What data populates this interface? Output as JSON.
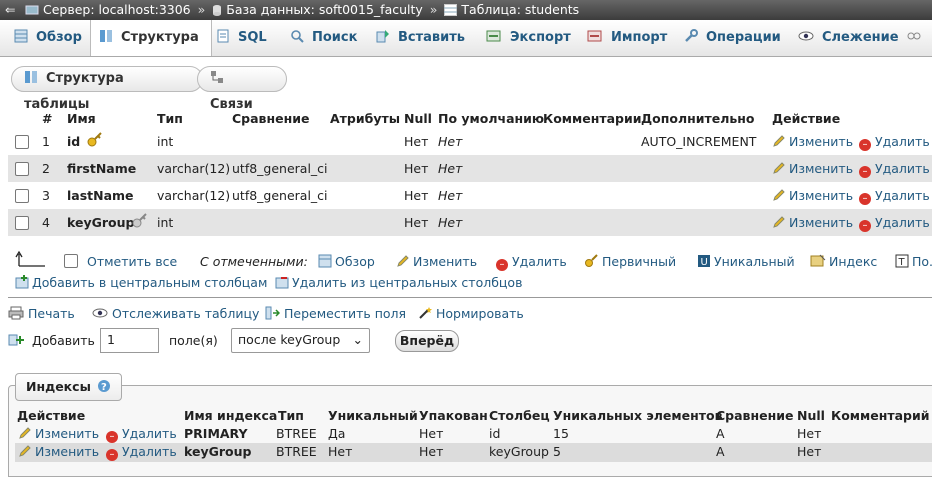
{
  "breadcrumb": {
    "server": "Сервер: localhost:3306",
    "database": "База данных: soft0015_faculty",
    "table": "Таблица: students",
    "sep": "»"
  },
  "tabs": [
    {
      "label": "Обзор",
      "icon": "browse-icon"
    },
    {
      "label": "Структура",
      "icon": "structure-icon",
      "active": true
    },
    {
      "label": "SQL",
      "icon": "sql-icon"
    },
    {
      "label": "Поиск",
      "icon": "search-icon"
    },
    {
      "label": "Вставить",
      "icon": "insert-icon"
    },
    {
      "label": "Экспорт",
      "icon": "export-icon"
    },
    {
      "label": "Импорт",
      "icon": "import-icon"
    },
    {
      "label": "Операции",
      "icon": "wrench-icon"
    },
    {
      "label": "Слежение",
      "icon": "eye-icon"
    }
  ],
  "subtabs": {
    "structure": "Структура таблицы",
    "relations": "Связи"
  },
  "columns_table": {
    "headers": [
      "#",
      "Имя",
      "Тип",
      "Сравнение",
      "Атрибуты",
      "Null",
      "По умолчанию",
      "Комментарии",
      "Дополнительно",
      "Действие"
    ],
    "rows": [
      {
        "num": "1",
        "name": "id",
        "type": "int",
        "collation": "",
        "null": "Нет",
        "default": "Нет",
        "extra": "AUTO_INCREMENT",
        "key": "primary"
      },
      {
        "num": "2",
        "name": "firstName",
        "type": "varchar(12)",
        "collation": "utf8_general_ci",
        "null": "Нет",
        "default": "Нет",
        "extra": "",
        "key": ""
      },
      {
        "num": "3",
        "name": "lastName",
        "type": "varchar(12)",
        "collation": "utf8_general_ci",
        "null": "Нет",
        "default": "Нет",
        "extra": "",
        "key": ""
      },
      {
        "num": "4",
        "name": "keyGroup",
        "type": "int",
        "collation": "",
        "null": "Нет",
        "default": "Нет",
        "extra": "",
        "key": "index"
      }
    ],
    "action_edit": "Изменить",
    "action_delete": "Удалить"
  },
  "bulk": {
    "check_all": "Отметить все",
    "with_selected": "С отмеченными:",
    "browse": "Обзор",
    "edit": "Изменить",
    "delete": "Удалить",
    "primary": "Первичный",
    "unique": "Уникальный",
    "index": "Индекс",
    "fulltext": "По...",
    "add_central": "Добавить в центральным столбцам",
    "remove_central": "Удалить из центральных столбцов"
  },
  "tools": {
    "print": "Печать",
    "track": "Отслеживать таблицу",
    "move": "Переместить поля",
    "normalize": "Нормировать"
  },
  "add_fields": {
    "label": "Добавить",
    "count": "1",
    "fields_label": "поле(я)",
    "position": "после keyGroup",
    "go": "Вперёд"
  },
  "indexes": {
    "legend": "Индексы",
    "headers": [
      "Действие",
      "Имя индекса",
      "Тип",
      "Уникальный",
      "Упакован",
      "Столбец",
      "Уникальных элементов",
      "Сравнение",
      "Null",
      "Комментарий"
    ],
    "rows": [
      {
        "edit": "Изменить",
        "delete": "Удалить",
        "name": "PRIMARY",
        "type": "BTREE",
        "unique": "Да",
        "packed": "Нет",
        "column": "id",
        "cardinality": "15",
        "collation": "A",
        "null": "Нет",
        "comment": ""
      },
      {
        "edit": "Изменить",
        "delete": "Удалить",
        "name": "keyGroup",
        "type": "BTREE",
        "unique": "Нет",
        "packed": "Нет",
        "column": "keyGroup",
        "cardinality": "5",
        "collation": "A",
        "null": "Нет",
        "comment": ""
      }
    ]
  }
}
